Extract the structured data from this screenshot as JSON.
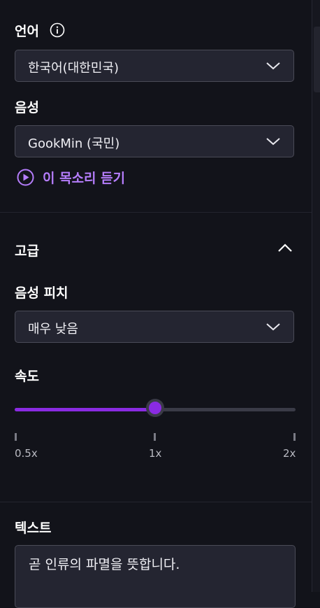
{
  "language": {
    "label": "언어",
    "selected": "한국어(대한민국)"
  },
  "voice": {
    "label": "음성",
    "selected": "GookMin (국민)",
    "preview_label": "이 목소리 듣기"
  },
  "advanced": {
    "title": "고급"
  },
  "pitch": {
    "label": "음성 피치",
    "selected": "매우 낮음"
  },
  "speed": {
    "label": "속도",
    "value_fraction": 0.5,
    "ticks": [
      "0.5x",
      "1x",
      "2x"
    ]
  },
  "text": {
    "label": "텍스트",
    "value": "곧 인류의 파멸을 뜻합니다."
  },
  "colors": {
    "accent": "#8a2be2",
    "accent_text": "#b57dfc",
    "background": "#12131a"
  },
  "icons": [
    "info-icon",
    "chevron-down-icon",
    "play-circle-icon",
    "chevron-up-icon"
  ]
}
